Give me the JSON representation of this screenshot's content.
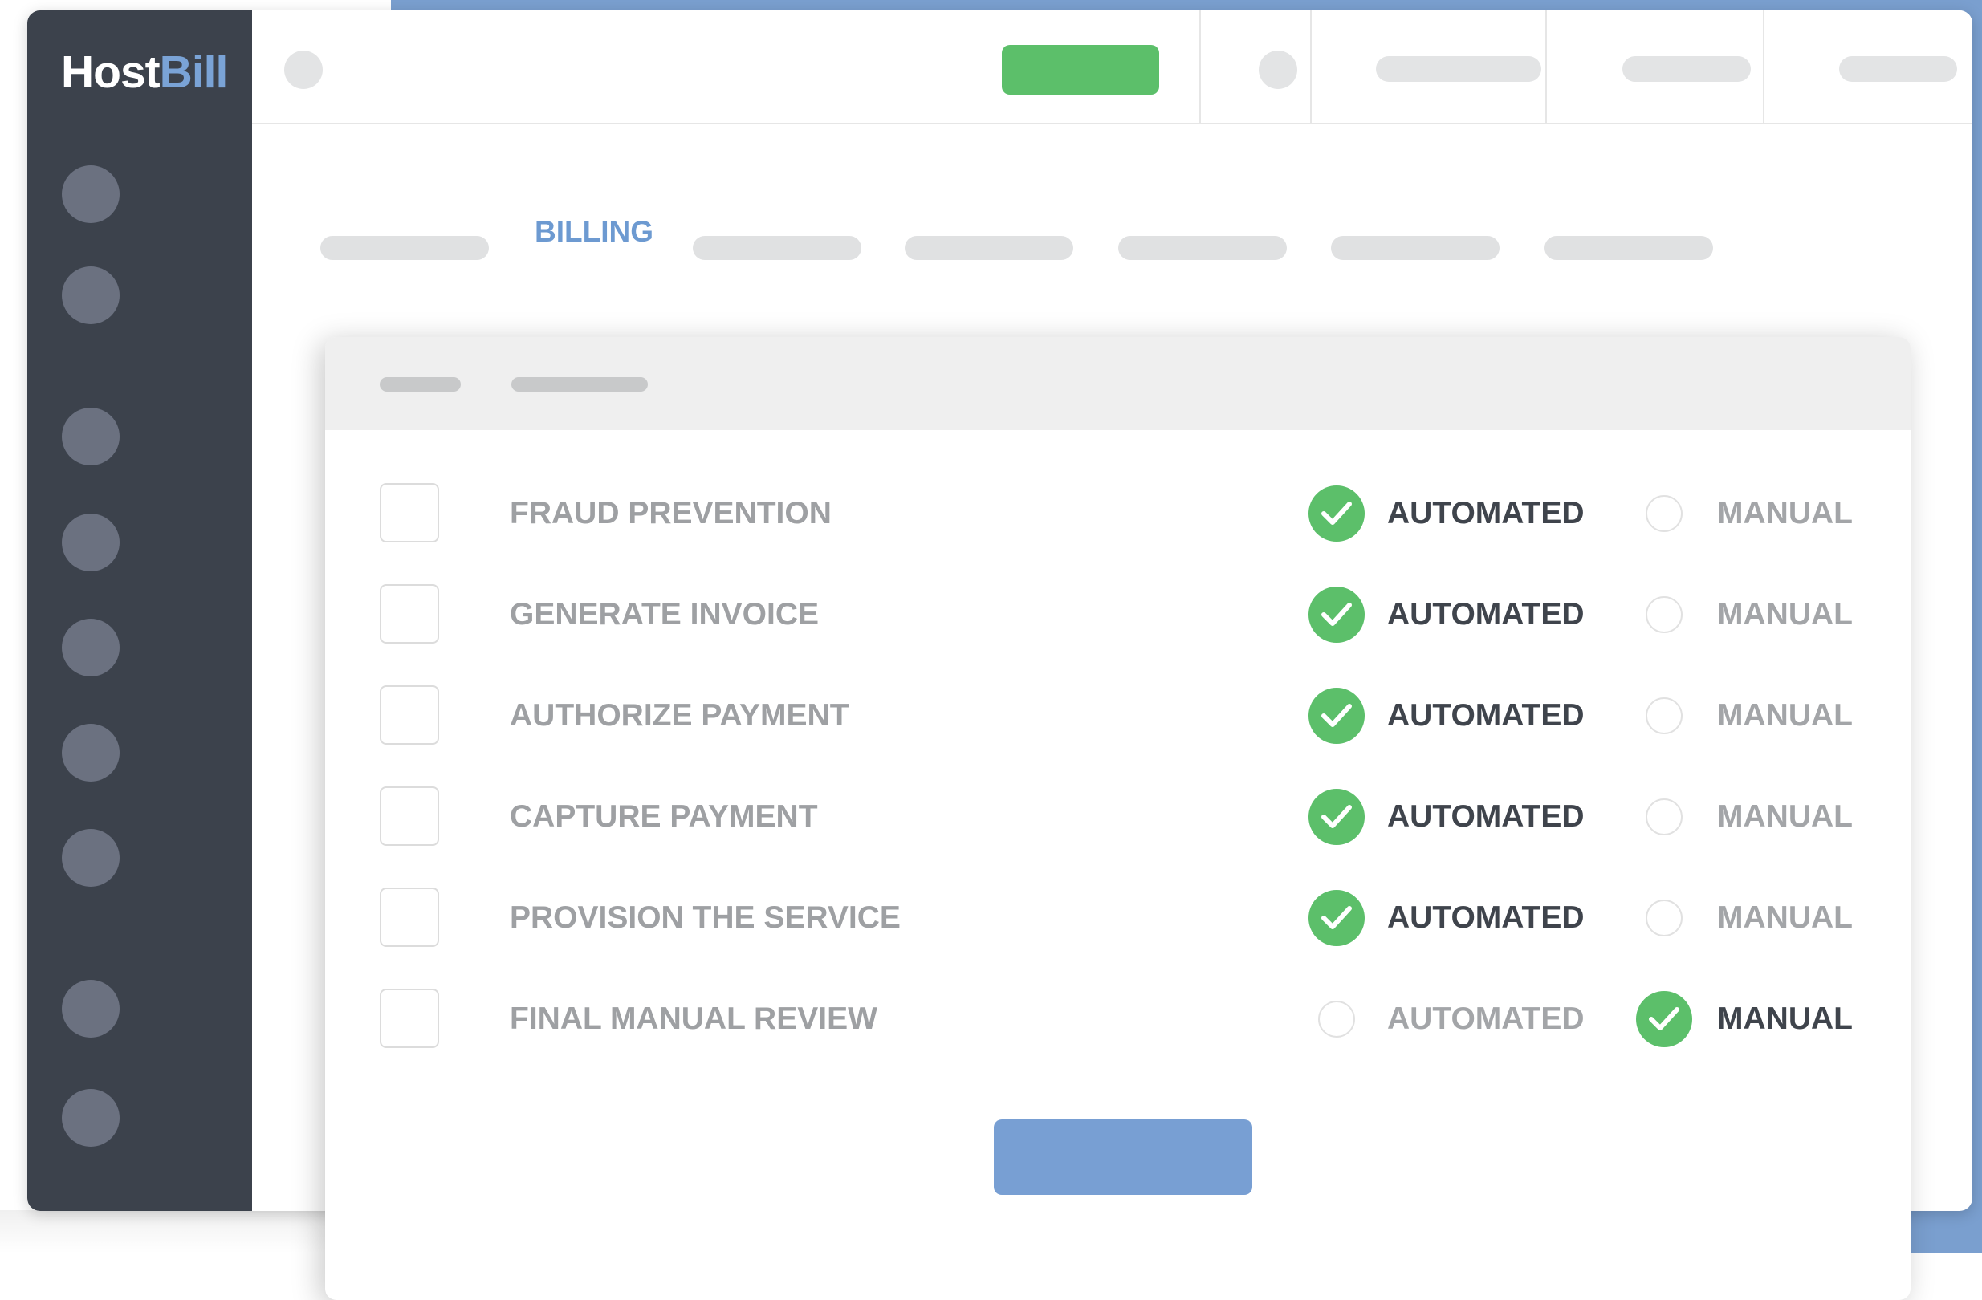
{
  "app": {
    "logo_part1": "Host",
    "logo_part2": "Bill"
  },
  "tabs": {
    "active_label": "BILLING"
  },
  "options": {
    "automated_label": "AUTOMATED",
    "manual_label": "MANUAL"
  },
  "rows": [
    {
      "label": "FRAUD PREVENTION",
      "selected": "automated"
    },
    {
      "label": "GENERATE INVOICE",
      "selected": "automated"
    },
    {
      "label": "AUTHORIZE PAYMENT",
      "selected": "automated"
    },
    {
      "label": "CAPTURE PAYMENT",
      "selected": "automated"
    },
    {
      "label": "PROVISION THE SERVICE",
      "selected": "automated"
    },
    {
      "label": "FINAL MANUAL REVIEW",
      "selected": "manual"
    }
  ],
  "colors": {
    "sidebar": "#3c424c",
    "accent_blue": "#789fd3",
    "success_green": "#5cbf6a",
    "active_tab": "#6d9ad1"
  }
}
